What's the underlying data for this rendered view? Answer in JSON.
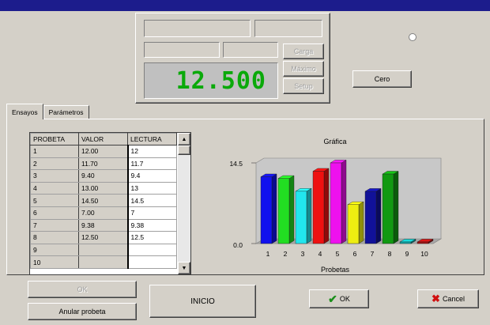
{
  "display": {
    "reading": "12.500"
  },
  "side_buttons": {
    "carga": "Carga",
    "maximo": "Máximo",
    "setup": "Setup"
  },
  "cero_button": "Cero",
  "tabs": [
    {
      "label": "Ensayos",
      "active": true
    },
    {
      "label": "Parámetros",
      "active": false
    }
  ],
  "table": {
    "headers": [
      "PROBETA",
      "VALOR",
      "LECTURA"
    ],
    "rows": [
      [
        "1",
        "12.00",
        "12"
      ],
      [
        "2",
        "11.70",
        "11.7"
      ],
      [
        "3",
        "9.40",
        "9.4"
      ],
      [
        "4",
        "13.00",
        "13"
      ],
      [
        "5",
        "14.50",
        "14.5"
      ],
      [
        "6",
        "7.00",
        "7"
      ],
      [
        "7",
        "9.38",
        "9.38"
      ],
      [
        "8",
        "12.50",
        "12.5"
      ],
      [
        "9",
        "",
        ""
      ],
      [
        "10",
        "",
        ""
      ]
    ]
  },
  "chart_data": {
    "type": "bar",
    "title": "Gráfica",
    "xlabel": "Probetas",
    "ylabel": "",
    "categories": [
      "1",
      "2",
      "3",
      "4",
      "5",
      "6",
      "7",
      "8",
      "9",
      "10"
    ],
    "values": [
      12.0,
      11.7,
      9.4,
      13.0,
      14.5,
      7.0,
      9.38,
      12.5,
      0,
      0
    ],
    "ytick_labels": [
      "14.5",
      "0.0"
    ],
    "ylim": [
      0,
      14.5
    ],
    "colors": [
      "#1111ee",
      "#22dd22",
      "#22e6ee",
      "#ee1111",
      "#ee11ee",
      "#eeee11",
      "#111199",
      "#119911",
      "#11aaaa",
      "#aa1111"
    ]
  },
  "buttons": {
    "ok_disabled": "OK",
    "anular": "Anular probeta",
    "inicio": "INICIO",
    "ok": "OK",
    "cancel": "Cancel"
  },
  "colors": {
    "lcd_text": "#0aa90a",
    "titlebar": "#1c1c8c"
  }
}
